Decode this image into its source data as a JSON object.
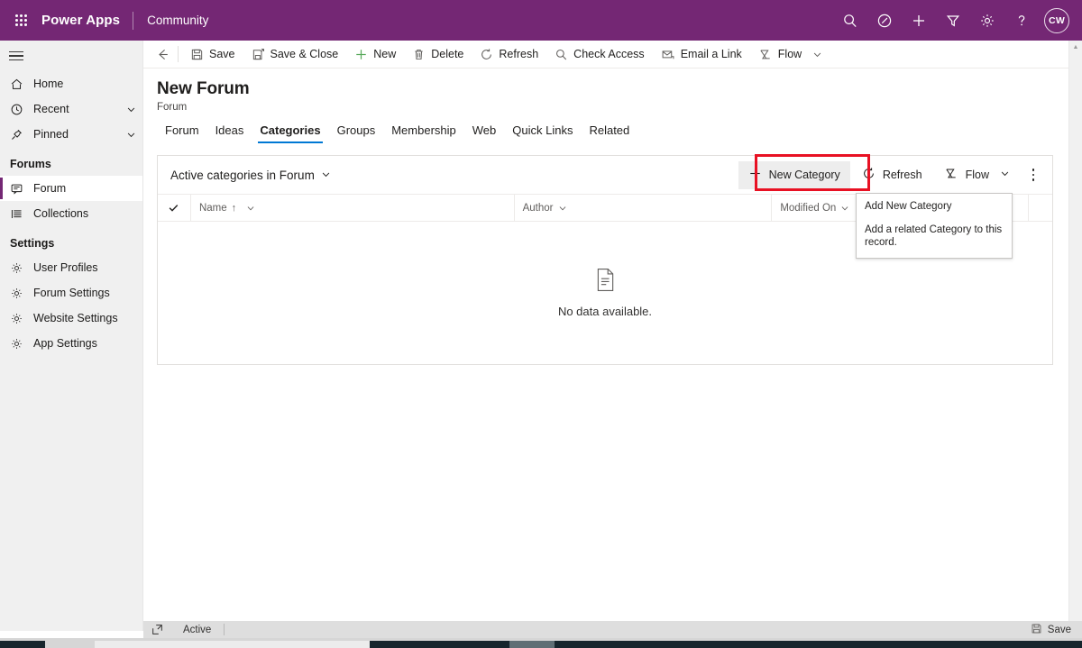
{
  "appbar": {
    "waffle_label": "app-launcher",
    "brand": "Power Apps",
    "environment": "Community",
    "icons": [
      {
        "name": "search-icon",
        "label": "Search"
      },
      {
        "name": "assistant-icon",
        "label": "Assistant"
      },
      {
        "name": "plus-icon",
        "label": "Quick create"
      },
      {
        "name": "filter-icon",
        "label": "Filter"
      },
      {
        "name": "gear-icon",
        "label": "Settings"
      },
      {
        "name": "help-icon",
        "label": "Help"
      }
    ],
    "avatar_initials": "CW"
  },
  "sidebar": {
    "hamburger_label": "Expand or collapse navigation",
    "top_items": [
      {
        "label": "Home",
        "icon": "home-icon",
        "chevron": false
      },
      {
        "label": "Recent",
        "icon": "clock-icon",
        "chevron": true
      },
      {
        "label": "Pinned",
        "icon": "pin-icon",
        "chevron": true
      }
    ],
    "groups": [
      {
        "title": "Forums",
        "items": [
          {
            "label": "Forum",
            "icon": "forum-icon",
            "selected": true
          },
          {
            "label": "Collections",
            "icon": "collections-icon",
            "selected": false
          }
        ]
      },
      {
        "title": "Settings",
        "items": [
          {
            "label": "User Profiles",
            "icon": "gear-icon",
            "selected": false
          },
          {
            "label": "Forum Settings",
            "icon": "gear-icon",
            "selected": false
          },
          {
            "label": "Website Settings",
            "icon": "gear-icon",
            "selected": false
          },
          {
            "label": "App Settings",
            "icon": "gear-icon",
            "selected": false
          }
        ]
      }
    ]
  },
  "commandbar": {
    "back_label": "Back",
    "buttons": [
      {
        "label": "Save",
        "icon": "save-icon"
      },
      {
        "label": "Save & Close",
        "icon": "save-close-icon"
      },
      {
        "label": "New",
        "icon": "plus-icon"
      },
      {
        "label": "Delete",
        "icon": "trash-icon"
      },
      {
        "label": "Refresh",
        "icon": "refresh-icon"
      },
      {
        "label": "Check Access",
        "icon": "check-access-icon"
      },
      {
        "label": "Email a Link",
        "icon": "email-link-icon"
      },
      {
        "label": "Flow",
        "icon": "flow-icon",
        "chevron": true
      }
    ]
  },
  "record": {
    "title": "New Forum",
    "subtitle": "Forum"
  },
  "tabs": [
    {
      "label": "Forum",
      "active": false
    },
    {
      "label": "Ideas",
      "active": false
    },
    {
      "label": "Categories",
      "active": true
    },
    {
      "label": "Groups",
      "active": false
    },
    {
      "label": "Membership",
      "active": false
    },
    {
      "label": "Web",
      "active": false
    },
    {
      "label": "Quick Links",
      "active": false
    },
    {
      "label": "Related",
      "active": false
    }
  ],
  "subgrid": {
    "view_name": "Active categories in Forum",
    "actions": [
      {
        "label": "New Category",
        "icon": "plus-icon",
        "highlighted": true
      },
      {
        "label": "Refresh",
        "icon": "refresh-icon",
        "highlighted": false
      },
      {
        "label": "Flow",
        "icon": "flow-icon",
        "chevron": true,
        "highlighted": false
      }
    ],
    "overflow_label": "More commands",
    "columns": [
      {
        "label": "Name",
        "sorted": true,
        "sort_arrow": "↑"
      },
      {
        "label": "Author",
        "sorted": false
      },
      {
        "label": "Modified On",
        "sorted": false
      }
    ],
    "empty_message": "No data available.",
    "empty_icon": "document-icon"
  },
  "callout": {
    "title": "Add New Category",
    "body": "Add a related Category to this record."
  },
  "annotation": {
    "highlight_color": "#e81123",
    "highlight_target": "New Category"
  },
  "statusbar": {
    "expand_label": "Open in new window",
    "status": "Active",
    "save_label": "Save",
    "save_icon": "save-icon"
  },
  "theme": {
    "brand_purple": "#742774",
    "accent_blue": "#0078d4",
    "sidebar_bg": "#f0f0f0"
  }
}
